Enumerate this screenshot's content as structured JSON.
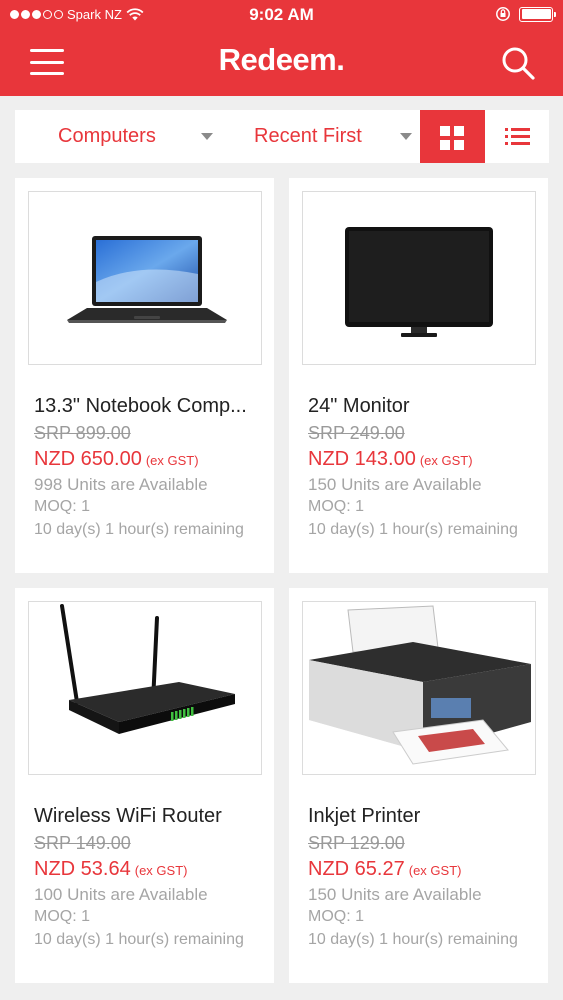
{
  "status_bar": {
    "carrier": "Spark NZ",
    "time": "9:02 AM"
  },
  "header": {
    "logo": "Redeem.",
    "menu_icon": "hamburger-menu-icon",
    "search_icon": "search-icon"
  },
  "filters": {
    "category": "Computers",
    "sort": "Recent First",
    "active_view": "grid"
  },
  "products": [
    {
      "name": "13.3\" Notebook Comp...",
      "srp": "SRP 899.00",
      "price_prefix": "NZD ",
      "price": "650.00",
      "price_note": "(ex GST)",
      "units": "998 Units are Available",
      "moq": "MOQ: 1",
      "remaining": "10 day(s) 1 hour(s) remaining"
    },
    {
      "name": "24\" Monitor",
      "srp": "SRP 249.00",
      "price_prefix": "NZD ",
      "price": "143.00",
      "price_note": "(ex GST)",
      "units": "150 Units are Available",
      "moq": "MOQ: 1",
      "remaining": "10 day(s) 1 hour(s) remaining"
    },
    {
      "name": "Wireless WiFi Router",
      "srp": "SRP 149.00",
      "price_prefix": "NZD ",
      "price": "53.64",
      "price_note": "(ex GST)",
      "units": "100 Units are Available",
      "moq": "MOQ: 1",
      "remaining": "10 day(s) 1 hour(s) remaining"
    },
    {
      "name": "Inkjet Printer",
      "srp": "SRP 129.00",
      "price_prefix": "NZD ",
      "price": "65.27",
      "price_note": "(ex GST)",
      "units": "150 Units are Available",
      "moq": "MOQ: 1",
      "remaining": "10 day(s) 1 hour(s) remaining"
    }
  ],
  "colors": {
    "brand_red": "#e8363b",
    "background": "#efefef",
    "muted_text": "#a5a5a5"
  }
}
